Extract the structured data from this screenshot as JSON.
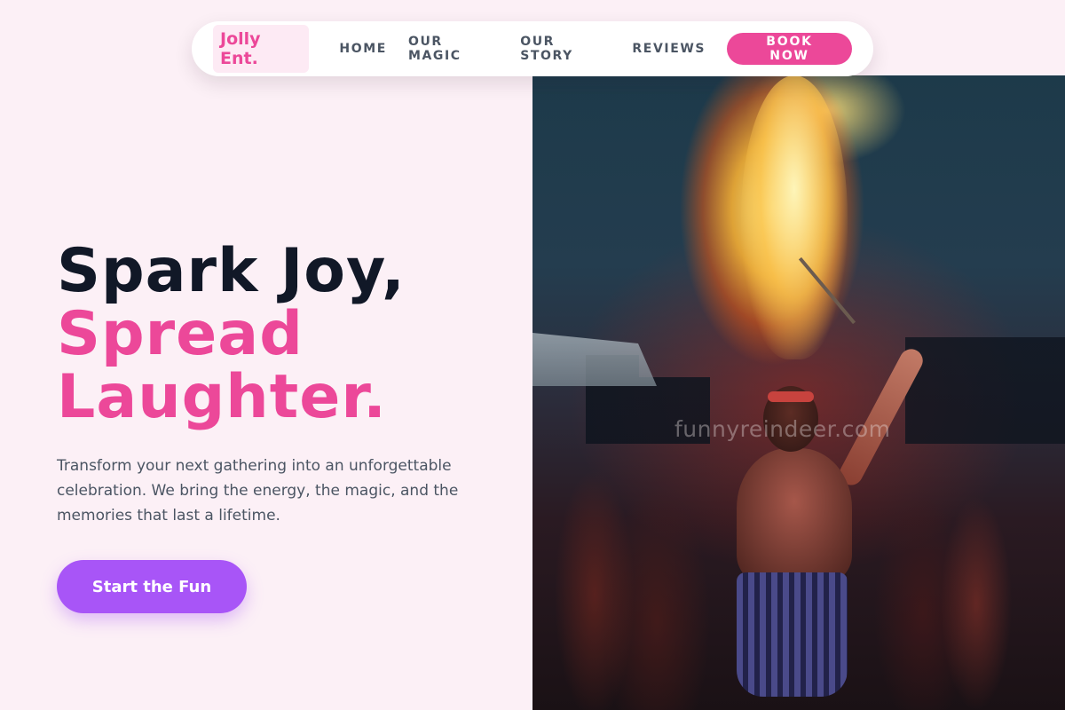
{
  "nav": {
    "brand": "Jolly Ent.",
    "links": [
      "HOME",
      "OUR MAGIC",
      "OUR STORY",
      "REVIEWS"
    ],
    "cta": "BOOK NOW"
  },
  "hero": {
    "title_line1": "Spark Joy,",
    "title_line2": "Spread",
    "title_line3": "Laughter.",
    "subtitle": "Transform your next gathering into an unforgettable celebration. We bring the energy, the magic, and the memories that last a lifetime.",
    "cta": "Start the Fun"
  },
  "photo": {
    "watermark": "funnyreindeer.com"
  },
  "colors": {
    "accent_pink": "#ec4899",
    "accent_purple": "#a855f7",
    "background": "#fcf0f6",
    "heading_dark": "#111827"
  }
}
